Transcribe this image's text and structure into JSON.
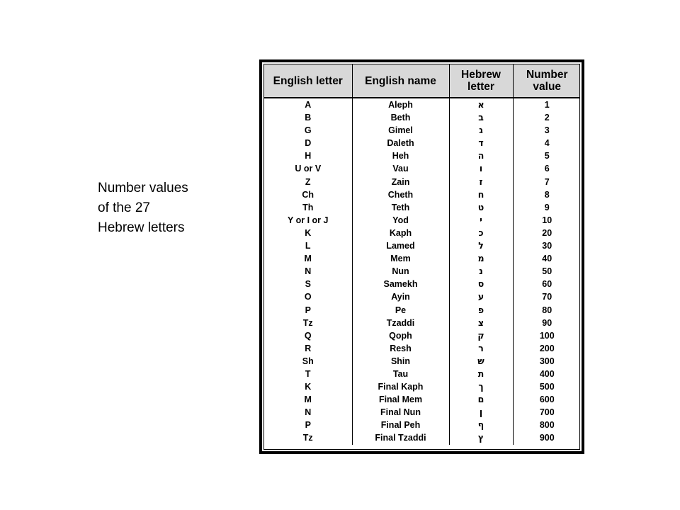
{
  "caption": {
    "text": "Number values\nof the 27\nHebrew letters"
  },
  "table": {
    "headers": [
      "English letter",
      "English name",
      "Hebrew letter",
      "Number value"
    ],
    "rows": [
      {
        "english_letter": "A",
        "english_name": "Aleph",
        "hebrew_letter": "א",
        "number_value": "1"
      },
      {
        "english_letter": "B",
        "english_name": "Beth",
        "hebrew_letter": "ב",
        "number_value": "2"
      },
      {
        "english_letter": "G",
        "english_name": "Gimel",
        "hebrew_letter": "ג",
        "number_value": "3"
      },
      {
        "english_letter": "D",
        "english_name": "Daleth",
        "hebrew_letter": "ד",
        "number_value": "4"
      },
      {
        "english_letter": "H",
        "english_name": "Heh",
        "hebrew_letter": "ה",
        "number_value": "5"
      },
      {
        "english_letter": "U or V",
        "english_name": "Vau",
        "hebrew_letter": "ו",
        "number_value": "6"
      },
      {
        "english_letter": "Z",
        "english_name": "Zain",
        "hebrew_letter": "ז",
        "number_value": "7"
      },
      {
        "english_letter": "Ch",
        "english_name": "Cheth",
        "hebrew_letter": "ח",
        "number_value": "8"
      },
      {
        "english_letter": "Th",
        "english_name": "Teth",
        "hebrew_letter": "ט",
        "number_value": "9"
      },
      {
        "english_letter": "Y or I or J",
        "english_name": "Yod",
        "hebrew_letter": "י",
        "number_value": "10"
      },
      {
        "english_letter": "K",
        "english_name": "Kaph",
        "hebrew_letter": "כ",
        "number_value": "20"
      },
      {
        "english_letter": "L",
        "english_name": "Lamed",
        "hebrew_letter": "ל",
        "number_value": "30"
      },
      {
        "english_letter": "M",
        "english_name": "Mem",
        "hebrew_letter": "מ",
        "number_value": "40"
      },
      {
        "english_letter": "N",
        "english_name": "Nun",
        "hebrew_letter": "נ",
        "number_value": "50"
      },
      {
        "english_letter": "S",
        "english_name": "Samekh",
        "hebrew_letter": "ס",
        "number_value": "60"
      },
      {
        "english_letter": "O",
        "english_name": "Ayin",
        "hebrew_letter": "ע",
        "number_value": "70"
      },
      {
        "english_letter": "P",
        "english_name": "Pe",
        "hebrew_letter": "פ",
        "number_value": "80"
      },
      {
        "english_letter": "Tz",
        "english_name": "Tzaddi",
        "hebrew_letter": "צ",
        "number_value": "90"
      },
      {
        "english_letter": "Q",
        "english_name": "Qoph",
        "hebrew_letter": "ק",
        "number_value": "100"
      },
      {
        "english_letter": "R",
        "english_name": "Resh",
        "hebrew_letter": "ר",
        "number_value": "200"
      },
      {
        "english_letter": "Sh",
        "english_name": "Shin",
        "hebrew_letter": "ש",
        "number_value": "300"
      },
      {
        "english_letter": "T",
        "english_name": "Tau",
        "hebrew_letter": "ת",
        "number_value": "400"
      },
      {
        "english_letter": "K",
        "english_name": "Final Kaph",
        "hebrew_letter": "ך",
        "number_value": "500"
      },
      {
        "english_letter": "M",
        "english_name": "Final Mem",
        "hebrew_letter": "ם",
        "number_value": "600"
      },
      {
        "english_letter": "N",
        "english_name": "Final Nun",
        "hebrew_letter": "ן",
        "number_value": "700"
      },
      {
        "english_letter": "P",
        "english_name": "Final Peh",
        "hebrew_letter": "ף",
        "number_value": "800"
      },
      {
        "english_letter": "Tz",
        "english_name": "Final Tzaddi",
        "hebrew_letter": "ץ",
        "number_value": "900"
      }
    ]
  },
  "colors": {
    "header_fill": "#d8d8d8",
    "border": "#000000",
    "text": "#000000",
    "background": "#ffffff"
  }
}
